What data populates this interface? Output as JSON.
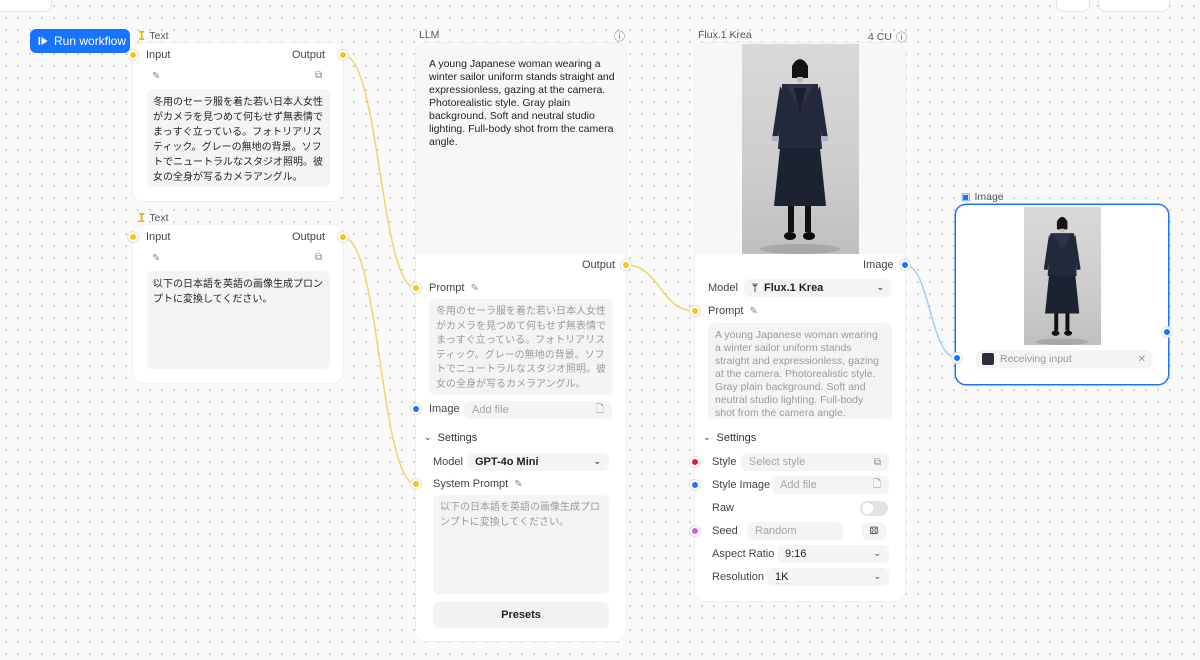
{
  "toolbar": {
    "run_label": "Run workflow"
  },
  "text_node_1": {
    "title": "Text",
    "input_label": "Input",
    "output_label": "Output",
    "content": "冬用のセーラ服を着た若い日本人女性がカメラを見つめて何もせず無表情でまっすぐ立っている。フォトリアリスティック。グレーの無地の背景。ソフトでニュートラルなスタジオ照明。彼女の全身が写るカメラアングル。"
  },
  "text_node_2": {
    "title": "Text",
    "input_label": "Input",
    "output_label": "Output",
    "content": "以下の日本語を英語の画像生成プロンプトに変換してください。"
  },
  "llm_node": {
    "title": "LLM",
    "output_text": "A young Japanese woman wearing a winter sailor uniform stands straight and expressionless, gazing at the camera. Photorealistic style. Gray plain background. Soft and neutral studio lighting. Full-body shot from the camera angle.",
    "output_label": "Output",
    "prompt_label": "Prompt",
    "prompt_placeholder": "冬用のセーラ服を着た若い日本人女性がカメラを見つめて何もせず無表情でまっすぐ立っている。フォトリアリスティック。グレーの無地の背景。ソフトでニュートラルなスタジオ照明。彼女の全身が写るカメラアングル。",
    "image_label": "Image",
    "image_placeholder": "Add file",
    "settings_label": "Settings",
    "model_label": "Model",
    "model_value": "GPT-4o Mini",
    "system_prompt_label": "System Prompt",
    "system_prompt_placeholder": "以下の日本語を英語の画像生成プロンプトに変換してください。",
    "presets_label": "Presets"
  },
  "flux_node": {
    "title": "Flux.1 Krea",
    "cost": "4 CU",
    "image_label": "Image",
    "model_label": "Model",
    "model_value": "Flux.1 Krea",
    "prompt_label": "Prompt",
    "prompt_placeholder": "A young Japanese woman wearing a winter sailor uniform stands straight and expressionless, gazing at the camera. Photorealistic style. Gray plain background. Soft and neutral studio lighting. Full-body shot from the camera angle.",
    "settings_label": "Settings",
    "style_label": "Style",
    "style_placeholder": "Select style",
    "style_image_label": "Style Image",
    "style_image_placeholder": "Add file",
    "raw_label": "Raw",
    "raw_enabled": false,
    "seed_label": "Seed",
    "seed_placeholder": "Random",
    "aspect_label": "Aspect Ratio",
    "aspect_value": "9:16",
    "resolution_label": "Resolution",
    "resolution_value": "1K"
  },
  "image_node": {
    "title": "Image",
    "status_text": "Receiving input"
  },
  "colors": {
    "accent": "#1a73ff",
    "text_port": "#f7c612",
    "image_port": "#1a73ff",
    "style_port": "#e4173b",
    "seed_port": "#d65ed6"
  }
}
